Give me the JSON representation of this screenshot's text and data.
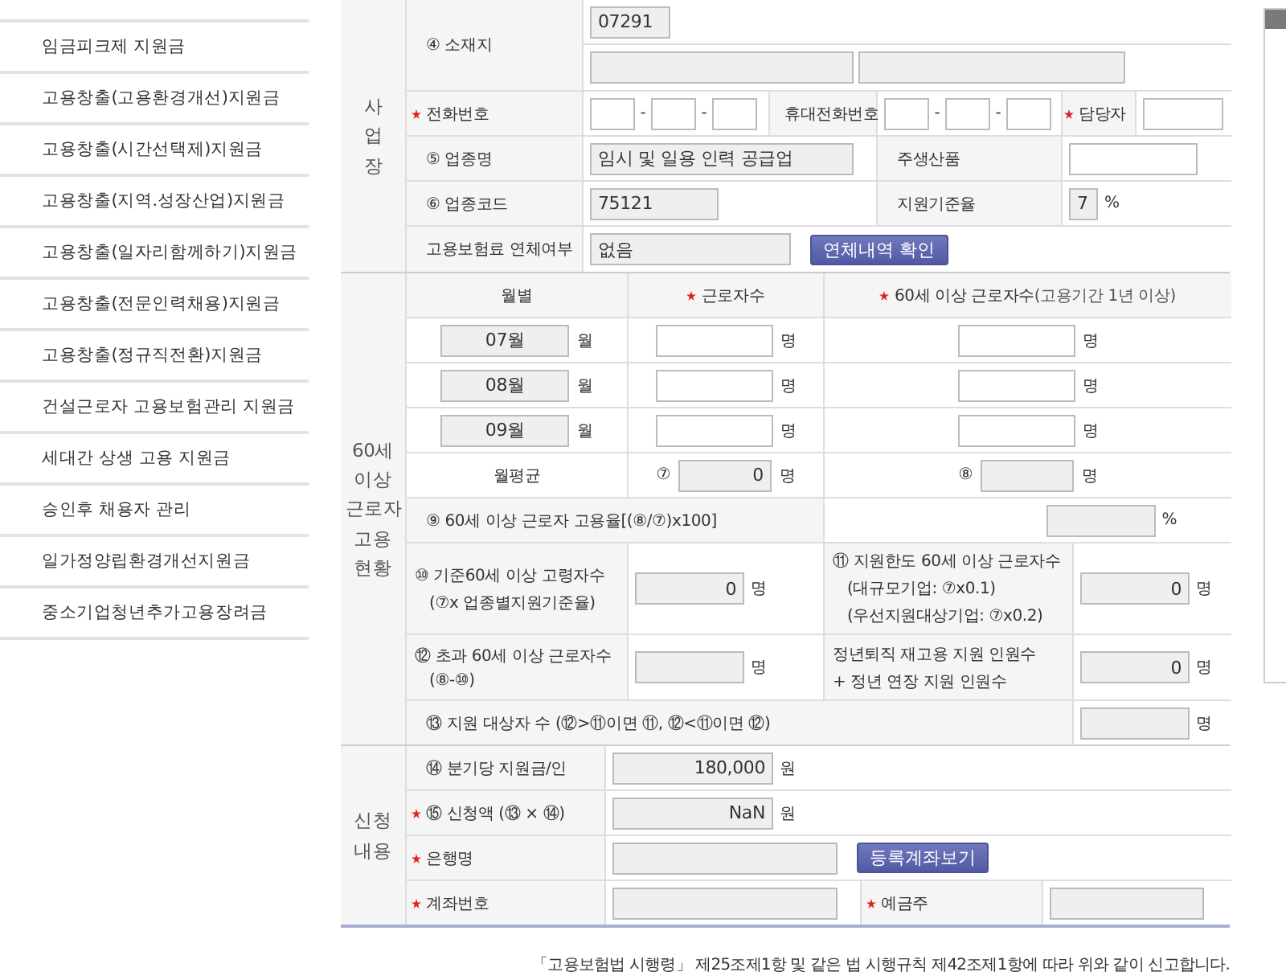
{
  "sidebar": {
    "items": [
      "임금피크제 지원금",
      "고용창출(고용환경개선)지원금",
      "고용창출(시간선택제)지원금",
      "고용창출(지역.성장산업)지원금",
      "고용창출(일자리함께하기)지원금",
      "고용창출(전문인력채용)지원금",
      "고용창출(정규직전환)지원금",
      "건설근로자 고용보험관리 지원금",
      "세대간 상생 고용 지원금",
      "승인후 채용자 관리",
      "일가정양립환경개선지원금",
      "중소기업청년추가고용장려금"
    ]
  },
  "business": {
    "heading": "사업장",
    "address": {
      "label": "④ 소재지",
      "postcode": "07291"
    },
    "phone": {
      "label": "전화번호",
      "required": true,
      "separators": [
        "-",
        "-"
      ]
    },
    "mobile": {
      "label": "휴대전화번호",
      "required": false,
      "separators": [
        "-",
        "-"
      ]
    },
    "manager": {
      "label": "담당자",
      "required": true
    },
    "industry_name": {
      "label": "⑤ 업종명",
      "value": "임시 및 일용 인력 공급업"
    },
    "main_product": {
      "label": "주생산품"
    },
    "industry_code": {
      "label": "⑥ 업종코드",
      "value": "75121"
    },
    "support_rate": {
      "label": "지원기준율",
      "value": "7",
      "unit": "%"
    },
    "arrears": {
      "label": "고용보험료 연체여부",
      "value": "없음",
      "button": "연체내역 확인"
    }
  },
  "employment": {
    "heading": "60세 이상 근로자 고용 현황",
    "columns": [
      {
        "label": "월별",
        "required": false
      },
      {
        "label": "근로자수",
        "required": true
      },
      {
        "label": "60세 이상 근로자수",
        "note": "(고용기간 1년 이상)",
        "required": true
      }
    ],
    "months": [
      {
        "month": "07월",
        "suffix": "월",
        "unit_1": "명",
        "unit_2": "명"
      },
      {
        "month": "08월",
        "suffix": "월",
        "unit_1": "명",
        "unit_2": "명"
      },
      {
        "month": "09월",
        "suffix": "월",
        "unit_1": "명",
        "unit_2": "명"
      }
    ],
    "average": {
      "label": "월평균",
      "workers_marker": "⑦",
      "workers_value": "0",
      "workers_unit": "명",
      "senior_marker": "⑧",
      "senior_unit": "명"
    },
    "rate": {
      "label": "⑨ 60세 이상 근로자 고용율[(⑧/⑦)x100]",
      "unit": "%"
    },
    "baseline": {
      "lines": [
        "⑩ 기준60세 이상 고령자수",
        "(⑦x 업종별지원기준율)"
      ],
      "value": "0",
      "unit": "명"
    },
    "limit": {
      "lines": [
        "⑪ 지원한도 60세 이상 근로자수",
        "(대규모기업: ⑦x0.1)",
        "(우선지원대상기업: ⑦x0.2)"
      ],
      "value": "0",
      "unit": "명"
    },
    "excess": {
      "lines": [
        "⑫ 초과 60세 이상 근로자수",
        "(⑧-⑩)"
      ],
      "unit": "명"
    },
    "reemploy": {
      "lines": [
        "정년퇴직 재고용 지원 인원수",
        "+ 정년 연장 지원 인원수"
      ],
      "value": "0",
      "unit": "명"
    },
    "eligible": {
      "label": "⑬ 지원 대상자 수 (⑫>⑪이면 ⑪, ⑫<⑪이면 ⑫)",
      "unit": "명"
    }
  },
  "application": {
    "heading": "신청 내용",
    "per_quarter": {
      "label": "⑭ 분기당 지원금/인",
      "required": false,
      "value": "180,000",
      "unit": "원"
    },
    "amount": {
      "label": "⑮ 신청액 (⑬ × ⑭)",
      "required": true,
      "value": "NaN",
      "unit": "원"
    },
    "bank": {
      "label": "은행명",
      "required": true,
      "button": "등록계좌보기"
    },
    "account": {
      "label": "계좌번호",
      "required": true
    },
    "holder": {
      "label": "예금주",
      "required": true
    }
  },
  "footer": "「고용보험법 시행령」 제25조제1항 및 같은 법 시행규칙 제42조제1항에 따라 위와 같이 신고합니다."
}
